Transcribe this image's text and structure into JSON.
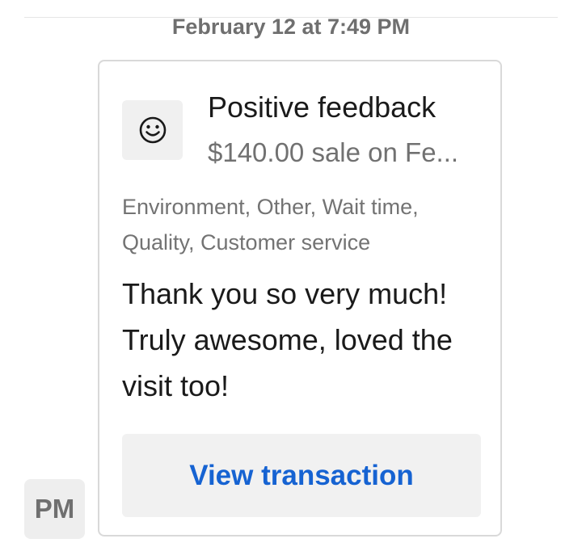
{
  "conversation": {
    "timestamp": "February 12 at 7:49 PM"
  },
  "feedback_card": {
    "icon": "smiley-face-icon",
    "title": "Positive feedback",
    "subtitle": "$140.00 sale on Fe...",
    "tags": "Environment, Other, Wait time, Quality, Customer service",
    "message": "Thank you so very much! Truly awesome, loved the visit too!",
    "action_label": "View transaction",
    "action_color": "#1663d2"
  },
  "sender": {
    "initials": "PM"
  }
}
